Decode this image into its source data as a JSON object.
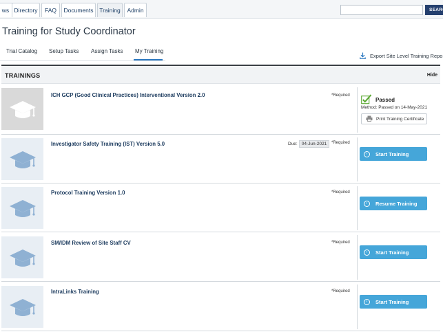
{
  "nav": {
    "tabs": [
      {
        "label": "ws"
      },
      {
        "label": "Directory"
      },
      {
        "label": "FAQ"
      },
      {
        "label": "Documents"
      },
      {
        "label": "Training"
      },
      {
        "label": "Admin"
      }
    ],
    "active_tab": "Training",
    "search_placeholder": "",
    "search_button": "SEARC"
  },
  "page_title": "Training for Study Coordinator",
  "subtabs": [
    {
      "label": "Trial Catalog"
    },
    {
      "label": "Setup Tasks"
    },
    {
      "label": "Assign Tasks"
    },
    {
      "label": "My Training"
    }
  ],
  "active_subtab": "My Training",
  "export_label": "Export Site Level Training Report",
  "section": {
    "title": "TRAININGS",
    "hide_label": "Hide"
  },
  "trainings": [
    {
      "name": "ICH GCP (Good Clinical Practices) Interventional Version 2.0",
      "required": "*Required",
      "status": "Passed",
      "method": "Method: Passed on 14-May-2021",
      "print_label": "Print Training Certificate"
    },
    {
      "name": "Investigator Safety Training (IST) Version 5.0",
      "required": "*Required",
      "due_label": "Due:",
      "due_date": "04-Jun-2021",
      "action": "Start Training"
    },
    {
      "name": "Protocol Training Version 1.0",
      "required": "*Required",
      "action": "Resume Training"
    },
    {
      "name": "SM/IDM Review of Site Staff CV",
      "required": "*Required",
      "action": "Start Training"
    },
    {
      "name": "IntraLinks Training",
      "required": "*Required",
      "action": "Start Training"
    }
  ],
  "colors": {
    "accent": "#45a6d9",
    "nav_text": "#1d3f66",
    "passed_check": "#5aa832",
    "search_button": "#243f6e"
  },
  "icons": {
    "thumbnail": "graduation-cap-icon",
    "export": "download-icon",
    "passed": "checkbox-check-icon",
    "print": "printer-icon",
    "action": "chevron-right-circle-icon"
  }
}
